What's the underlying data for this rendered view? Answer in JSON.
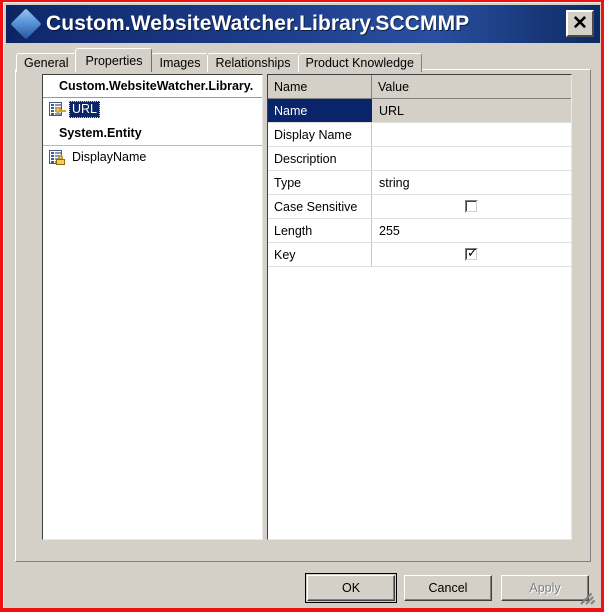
{
  "window": {
    "title": "Custom.WebsiteWatcher.Library.SCCMMP",
    "icon": "diamond-icon",
    "close_label": "✕"
  },
  "tabs": [
    {
      "label": "General",
      "selected": false
    },
    {
      "label": "Properties",
      "selected": true
    },
    {
      "label": "Images",
      "selected": false
    },
    {
      "label": "Relationships",
      "selected": false
    },
    {
      "label": "Product Knowledge",
      "selected": false
    }
  ],
  "tree": {
    "header": "Custom.WebsiteWatcher.Library.",
    "items": [
      {
        "label": "URL",
        "icon": "property-key-icon",
        "selected": true
      },
      {
        "label": "System.Entity",
        "type": "group"
      },
      {
        "label": "DisplayName",
        "icon": "property-lock-icon",
        "selected": false
      }
    ]
  },
  "grid": {
    "columns": [
      "Name",
      "Value"
    ],
    "rows": [
      {
        "name": "Name",
        "value": "URL",
        "kind": "text",
        "selected": true
      },
      {
        "name": "Display Name",
        "value": "",
        "kind": "text",
        "selected": false
      },
      {
        "name": "Description",
        "value": "",
        "kind": "text",
        "selected": false
      },
      {
        "name": "Type",
        "value": "string",
        "kind": "text",
        "selected": false
      },
      {
        "name": "Case Sensitive",
        "value": "",
        "kind": "checkbox",
        "checked": false,
        "selected": false
      },
      {
        "name": "Length",
        "value": "255",
        "kind": "text",
        "selected": false
      },
      {
        "name": "Key",
        "value": "",
        "kind": "checkbox",
        "checked": true,
        "selected": false
      }
    ]
  },
  "footer": {
    "ok_label": "OK",
    "cancel_label": "Cancel",
    "apply_label": "Apply",
    "apply_enabled": false
  },
  "colors": {
    "titlebar_navy": "#1b3a87",
    "selection_navy": "#0a246a",
    "window_face": "#d4d0c8",
    "capture_border_red": "#ee1111"
  }
}
